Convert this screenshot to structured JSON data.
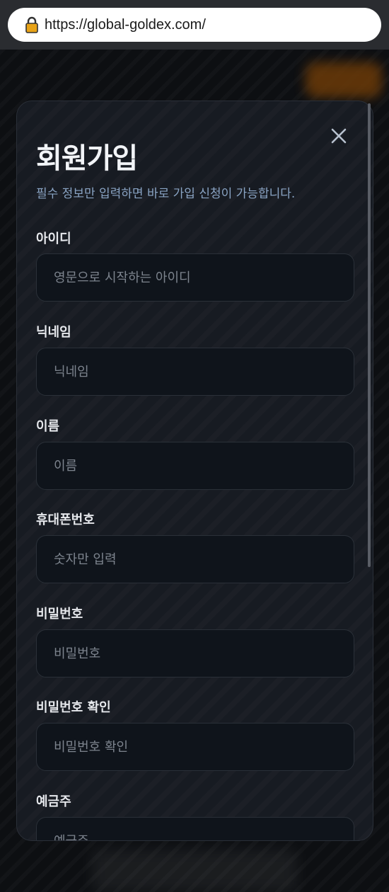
{
  "browser": {
    "url": "https://global-goldex.com/"
  },
  "modal": {
    "title": "회원가입",
    "subtitle": "필수 정보만 입력하면 바로 가입 신청이 가능합니다.",
    "fields": [
      {
        "label": "아이디",
        "placeholder": "영문으로 시작하는 아이디",
        "value": ""
      },
      {
        "label": "닉네임",
        "placeholder": "닉네임",
        "value": ""
      },
      {
        "label": "이름",
        "placeholder": "이름",
        "value": ""
      },
      {
        "label": "휴대폰번호",
        "placeholder": "숫자만 입력",
        "value": ""
      },
      {
        "label": "비밀번호",
        "placeholder": "비밀번호",
        "value": ""
      },
      {
        "label": "비밀번호 확인",
        "placeholder": "비밀번호 확인",
        "value": ""
      },
      {
        "label": "예금주",
        "placeholder": "예금주",
        "value": ""
      }
    ]
  },
  "icons": {
    "lock": "lock-icon",
    "close": "close-icon"
  },
  "colors": {
    "modal_bg": "#171b22",
    "input_bg": "#0f141b",
    "subtitle": "#8aa4c4",
    "lock_body": "#e8a317"
  }
}
